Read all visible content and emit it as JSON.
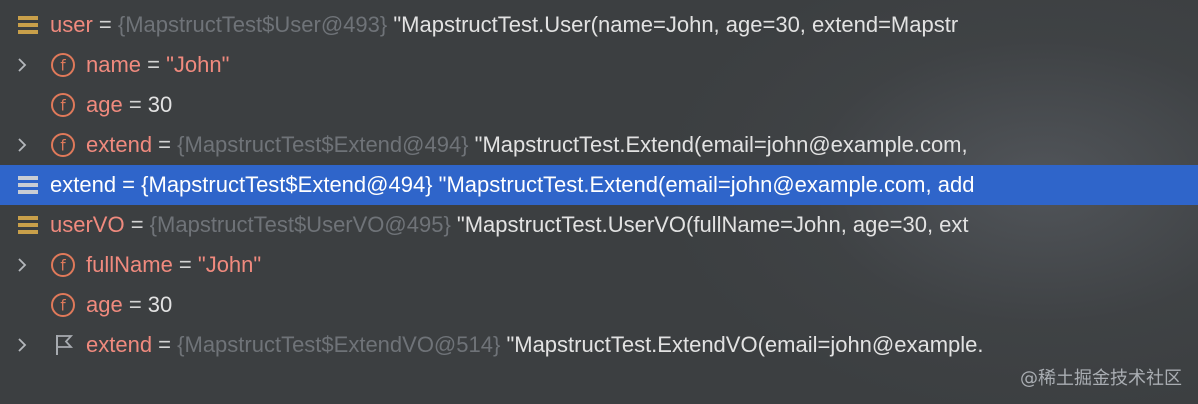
{
  "colors": {
    "background": "#3c3f41",
    "selection": "#2f65ca",
    "variable_name": "#f08a7e",
    "reference": "#6f7378",
    "value_text": "#e2e2e2"
  },
  "rows": [
    {
      "icon": "variable-list-icon",
      "name": "user",
      "op": " = ",
      "ref": "{MapstructTest$User@493}",
      "value": " \"MapstructTest.User(name=John, age=30, extend=Mapstr"
    },
    {
      "icon": "field-icon",
      "field_letter": "f",
      "name": "name",
      "op": " = ",
      "value": "\"John\""
    },
    {
      "icon": "field-icon",
      "field_letter": "f",
      "name": "age",
      "op": " = ",
      "value": "30"
    },
    {
      "icon": "field-icon",
      "field_letter": "f",
      "name": "extend",
      "op": " = ",
      "ref": "{MapstructTest$Extend@494}",
      "value": " \"MapstructTest.Extend(email=john@example.com, "
    },
    {
      "icon": "variable-list-icon",
      "name": "extend",
      "op": " = ",
      "ref": "{MapstructTest$Extend@494}",
      "value": " \"MapstructTest.Extend(email=john@example.com, add"
    },
    {
      "icon": "variable-list-icon",
      "name": "userVO",
      "op": " = ",
      "ref": "{MapstructTest$UserVO@495}",
      "value": " \"MapstructTest.UserVO(fullName=John, age=30, ext"
    },
    {
      "icon": "field-icon",
      "field_letter": "f",
      "name": "fullName",
      "op": " = ",
      "value": "\"John\""
    },
    {
      "icon": "field-icon",
      "field_letter": "f",
      "name": "age",
      "op": " = ",
      "value": "30"
    },
    {
      "icon": "flag-icon",
      "name": "extend",
      "op": " = ",
      "ref": "{MapstructTest$ExtendVO@514}",
      "value": " \"MapstructTest.ExtendVO(email=john@example."
    }
  ],
  "watermark": "@稀土掘金技术社区"
}
